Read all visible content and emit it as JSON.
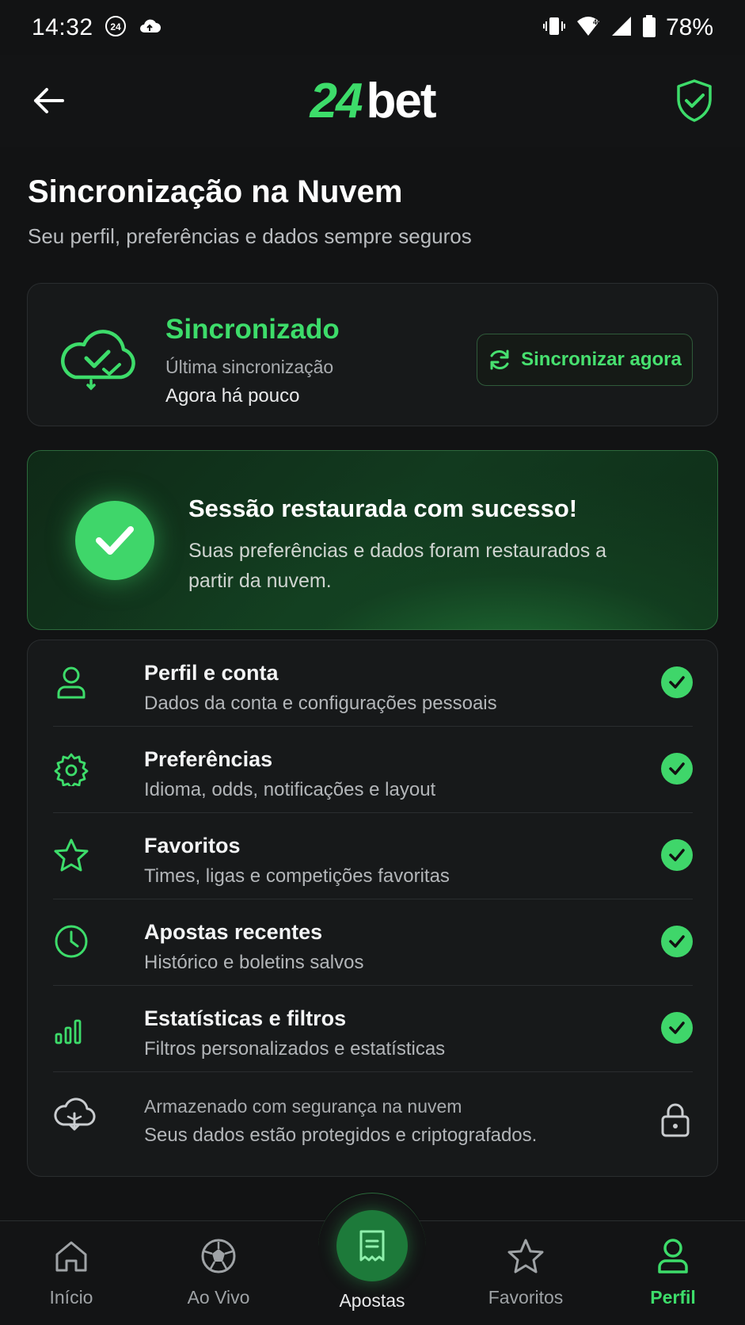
{
  "status_bar": {
    "time": "14:32",
    "badge": "24",
    "battery": "78%"
  },
  "header": {
    "logo_num": "24",
    "logo_word": "bet",
    "icons": {
      "back": "arrow-left-icon",
      "shield": "shield-check-icon"
    }
  },
  "page": {
    "title": "Sincronização na Nuvem",
    "subtitle": "Seu perfil, preferências e dados sempre seguros"
  },
  "sync": {
    "status": "Sincronizado",
    "last_label": "Última sincronização",
    "last_value": "Agora há pouco",
    "button": "Sincronizar agora"
  },
  "banner": {
    "title": "Sessão restaurada com sucesso!",
    "text": "Suas preferências e dados foram restaurados a partir da nuvem."
  },
  "items": [
    {
      "title": "Perfil e conta",
      "desc": "Dados da conta e configurações pessoais",
      "icon": "user-icon"
    },
    {
      "title": "Preferências",
      "desc": "Idioma, odds, notificações e layout",
      "icon": "gear-icon"
    },
    {
      "title": "Favoritos",
      "desc": "Times, ligas e competições favoritas",
      "icon": "star-icon"
    },
    {
      "title": "Apostas recentes",
      "desc": "Histórico e boletins salvos",
      "icon": "clock-icon"
    },
    {
      "title": "Estatísticas e filtros",
      "desc": "Filtros personalizados e estatísticas",
      "icon": "bar-chart-icon"
    }
  ],
  "secure": {
    "line1": "Armazenado com segurança na nuvem",
    "line2": "Seus dados estão protegidos e criptografados."
  },
  "nav": {
    "items": [
      {
        "label": "Início",
        "icon": "home-icon"
      },
      {
        "label": "Ao Vivo",
        "icon": "soccer-ball-icon"
      },
      {
        "label": "Apostas",
        "icon": "ticket-icon"
      },
      {
        "label": "Favoritos",
        "icon": "star-icon"
      },
      {
        "label": "Perfil",
        "icon": "user-icon"
      }
    ],
    "active": "Perfil"
  },
  "colors": {
    "accent": "#3ddc6a",
    "background": "#121314",
    "card": "#17191a",
    "banner": "#123a1f"
  }
}
